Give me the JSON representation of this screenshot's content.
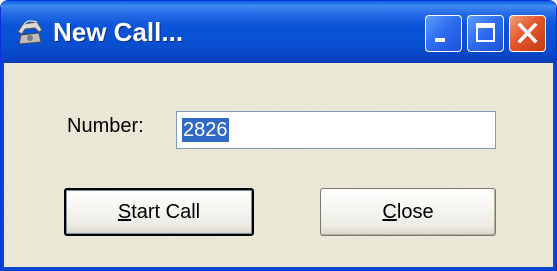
{
  "window": {
    "title": "New Call..."
  },
  "titlebar": {
    "app_icon": "telephone-icon",
    "minimize_icon": "minimize-icon",
    "maximize_icon": "maximize-icon",
    "close_icon": "close-icon",
    "accent_color": "#0a54d8",
    "close_color": "#e2562a"
  },
  "form": {
    "number_label": "Number:",
    "number_value": "2826",
    "number_selection_color": "#316ac5"
  },
  "buttons": {
    "start_call": {
      "mnemonic": "S",
      "rest": "tart Call"
    },
    "close": {
      "mnemonic": "C",
      "rest": "lose"
    }
  }
}
